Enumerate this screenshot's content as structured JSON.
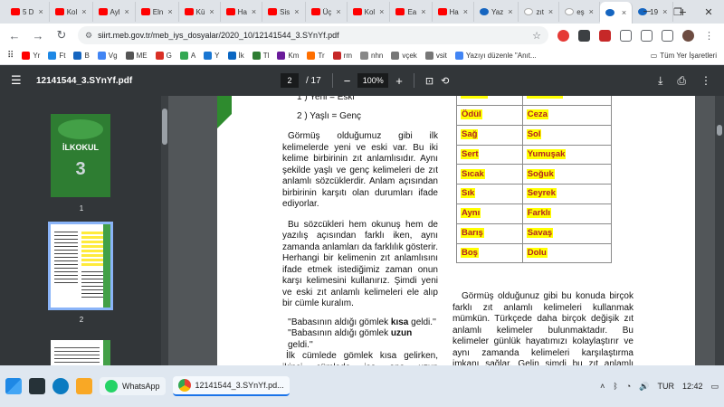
{
  "browser": {
    "tabs": [
      {
        "label": "5 D",
        "icon": "youtube-icon"
      },
      {
        "label": "Kol",
        "icon": "youtube-icon"
      },
      {
        "label": "Ayl",
        "icon": "youtube-icon"
      },
      {
        "label": "Eln",
        "icon": "youtube-icon"
      },
      {
        "label": "Kü",
        "icon": "youtube-icon"
      },
      {
        "label": "Ha",
        "icon": "youtube-icon"
      },
      {
        "label": "Sis",
        "icon": "youtube-icon"
      },
      {
        "label": "Üç",
        "icon": "youtube-icon"
      },
      {
        "label": "Kol",
        "icon": "youtube-icon"
      },
      {
        "label": "Ea",
        "icon": "youtube-icon"
      },
      {
        "label": "Ha",
        "icon": "youtube-icon"
      },
      {
        "label": "Yaz",
        "icon": "blue-icon"
      },
      {
        "label": "zıt",
        "icon": "google-icon"
      },
      {
        "label": "eş",
        "icon": "google-icon"
      },
      {
        "label": "",
        "icon": "globe-icon",
        "active": true
      },
      {
        "label": "19",
        "icon": "globe-icon"
      }
    ],
    "url": "siirt.meb.gov.tr/meb_iys_dosyalar/2020_10/12141544_3.SYnYf.pdf",
    "bookmarks": [
      "Yr",
      "Ft",
      "B",
      "Vg",
      "ME",
      "G",
      "A",
      "Y",
      "İk",
      "Tl",
      "Km",
      "Tr",
      "rm",
      "nhn",
      "vçek",
      "vsit",
      "Yazıyı düzenle \"Anıt..."
    ],
    "bookmarks_right": "Tüm Yer İşaretleri"
  },
  "pdf": {
    "filename": "12141544_3.SYnYf.pdf",
    "current_page": "2",
    "total_pages": "/ 17",
    "zoom": "100%",
    "thumbnails": [
      {
        "num": "1",
        "cover_title": "İLKOKUL",
        "cover_number": "3"
      },
      {
        "num": "2"
      },
      {
        "num": ""
      }
    ]
  },
  "document": {
    "lines_top": [
      "1 ) Yeni = Eski",
      "2 ) Yaşlı = Genç"
    ],
    "para1": "Görmüş olduğumuz gibi ilk kelimelerde yeni ve eski var. Bu iki kelime birbirinin zıt anlamlısıdır. Aynı şekilde yaşlı ve genç kelimeleri de zıt anlamlı sözcüklerdir. Anlam açısından birbirinin karşıtı olan durumları ifade ediyorlar.",
    "para2": "Bu sözcükleri hem okunuş hem de yazılış açısından farklı iken, aynı zamanda anlamları da farklılık gösterir. Herhangi bir kelimenin zıt anlamlısını ifade etmek istediğimiz zaman onun karşı kelimesini kullanırız. Şimdi yeni ve eski zıt anlamlı kelimeleri ele alıp bir cümle kuralım.",
    "quote1_pre": "''Babasının aldığı gömlek ",
    "quote1_bold": "kısa",
    "quote1_post": " geldi.''",
    "quote2_pre": "''Babasının aldığı gömlek ",
    "quote2_bold": "uzun",
    "quote2_post": " geldi.''",
    "para3": "İlk cümlede gömlek kısa gelirken, ikinci cümlede ise ona uzun gelmektedir. Yani cümlenin birinde gömlek kısa iken diğerinde ise uzun olduğu anlatılır. Buradan da görüyoruz ki kısa ve uzun kelimeleri zıt anlamlı",
    "table_rows": [
      [
        "Ödül",
        "Ceza"
      ],
      [
        "Sağ",
        "Sol"
      ],
      [
        "Sert",
        "Yumuşak"
      ],
      [
        "Sıcak",
        "Soğuk"
      ],
      [
        "Sık",
        "Seyrek"
      ],
      [
        "Aynı",
        "Farklı"
      ],
      [
        "Barış",
        "Savaş"
      ],
      [
        "Boş",
        "Dolu"
      ]
    ],
    "para_right": "Görmüş olduğunuz gibi bu konuda birçok farklı zıt anlamlı kelimeleri kullanmak mümkün. Türkçede daha birçok değişik zıt anlamlı kelimeler bulunmaktadır. Bu kelimeler günlük hayatımızı kolaylaştırır ve aynı zamanda kelimeleri karşılaştırma imkanı sağlar. Gelin şimdi bu zıt anlamlı kelimeler ile farklı cümleler kuralım."
  },
  "taskbar": {
    "apps": [
      {
        "label": "WhatsApp",
        "icon": "whatsapp-icon"
      },
      {
        "label": "12141544_3.SYnYf.pd...",
        "icon": "chrome-icon"
      }
    ],
    "language": "TUR",
    "time": "12:42"
  },
  "colors": {
    "pdf_toolbar": "#323639",
    "viewer_bg": "#525659",
    "highlight": "#ffff00",
    "word_red": "#b22222",
    "green": "#2e8b2e"
  }
}
